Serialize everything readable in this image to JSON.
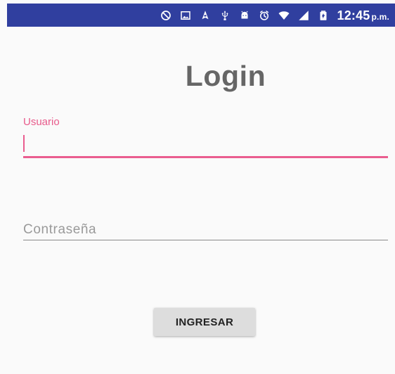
{
  "status_bar": {
    "time": "12:45",
    "time_suffix": "p.m.",
    "icons": [
      "do-not-disturb-icon",
      "image-icon",
      "navigation-icon",
      "usb-icon",
      "android-icon",
      "alarm-icon",
      "wifi-icon",
      "signal-icon",
      "battery-icon"
    ]
  },
  "login": {
    "title": "Login",
    "username_label": "Usuario",
    "username_value": "",
    "password_placeholder": "Contraseña",
    "password_value": "",
    "submit_label": "INGRESAR"
  },
  "colors": {
    "status_bar": "#303f9f",
    "accent": "#ea5d8f",
    "title": "#666666",
    "button": "#dddddd"
  }
}
